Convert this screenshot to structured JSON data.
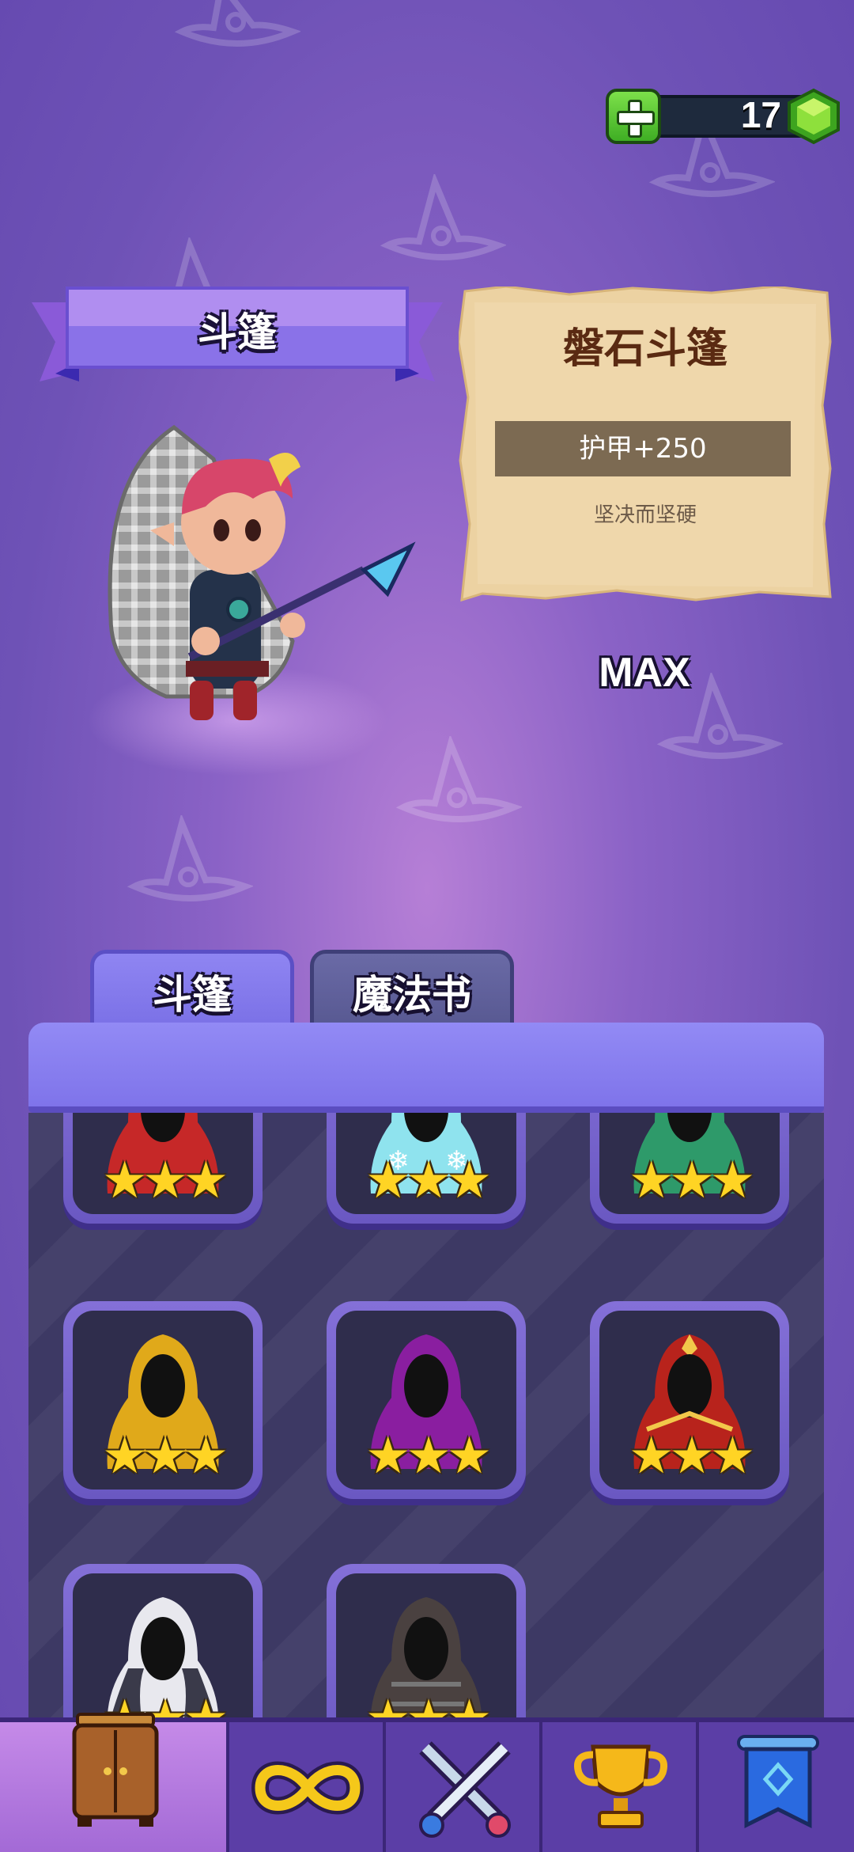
{
  "currency": {
    "gems": "17"
  },
  "category_ribbon": {
    "label": "斗篷"
  },
  "item_card": {
    "name": "磐石斗篷",
    "stat": "护甲+250",
    "description": "坚决而坚硬"
  },
  "level_label": "MAX",
  "tabs": [
    {
      "label": "斗篷",
      "active": true
    },
    {
      "label": "魔法书",
      "active": false
    }
  ],
  "cloaks": [
    {
      "color": "#c62828",
      "stars": 3
    },
    {
      "color": "#8fe3ee",
      "stars": 3
    },
    {
      "color": "#2e9a6a",
      "stars": 3
    },
    {
      "color": "#e0a91a",
      "stars": 3
    },
    {
      "color": "#8a1ea0",
      "stars": 3
    },
    {
      "color": "#b8231c",
      "stars": 3
    },
    {
      "color": "#e8e8ee",
      "stars": 3
    },
    {
      "color": "#4a4140",
      "stars": 3
    }
  ],
  "stars_text": "★★★",
  "bottom_nav": [
    {
      "icon": "wardrobe-icon",
      "active": true
    },
    {
      "icon": "infinity-icon",
      "active": false
    },
    {
      "icon": "crossed-swords-icon",
      "active": false
    },
    {
      "icon": "trophy-icon",
      "active": false
    },
    {
      "icon": "banner-icon",
      "active": false
    }
  ]
}
